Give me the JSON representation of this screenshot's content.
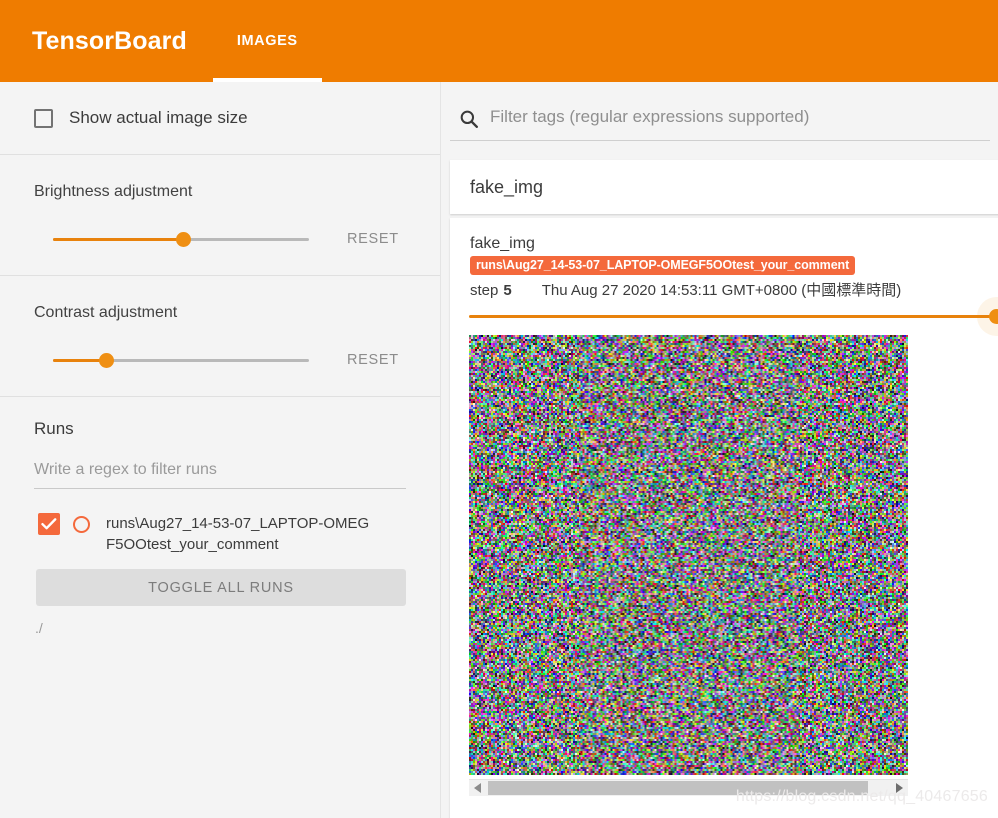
{
  "app": {
    "brand": "TensorBoard",
    "accent_color": "#ef7c00",
    "run_color": "#f4693c"
  },
  "tabs": [
    {
      "label": "IMAGES",
      "active": true
    }
  ],
  "sidebar": {
    "show_actual_size": {
      "label": "Show actual image size",
      "checked": false
    },
    "brightness": {
      "title": "Brightness adjustment",
      "reset_label": "RESET",
      "value_percent": 51
    },
    "contrast": {
      "title": "Contrast adjustment",
      "reset_label": "RESET",
      "value_percent": 21
    },
    "runs": {
      "title": "Runs",
      "filter_placeholder": "Write a regex to filter runs",
      "filter_value": "",
      "items": [
        {
          "label": "runs\\Aug27_14-53-07_LAPTOP-OMEGF5OOtest_your_comment",
          "checked": true,
          "selected": false
        }
      ],
      "toggle_all_label": "TOGGLE ALL RUNS",
      "logdir": "./"
    }
  },
  "main": {
    "filter": {
      "placeholder": "Filter tags (regular expressions supported)",
      "value": "",
      "icon": "search-icon"
    },
    "tag_group": {
      "title": "fake_img"
    },
    "image_card": {
      "tag": "fake_img",
      "run_badge": "runs\\Aug27_14-53-07_LAPTOP-OMEGF5OOtest_your_comment",
      "step_label": "step",
      "step_value": "5",
      "wall_time": "Thu Aug 27 2020 14:53:11 GMT+0800 (中國標準時間)",
      "step_slider_percent": 100,
      "scrollbar": {
        "left_arrow": "scroll-left-icon",
        "right_arrow": "scroll-right-icon",
        "thumb_percent": 87
      }
    }
  },
  "watermark": "https://blog.csdn.net/qq_40467656"
}
